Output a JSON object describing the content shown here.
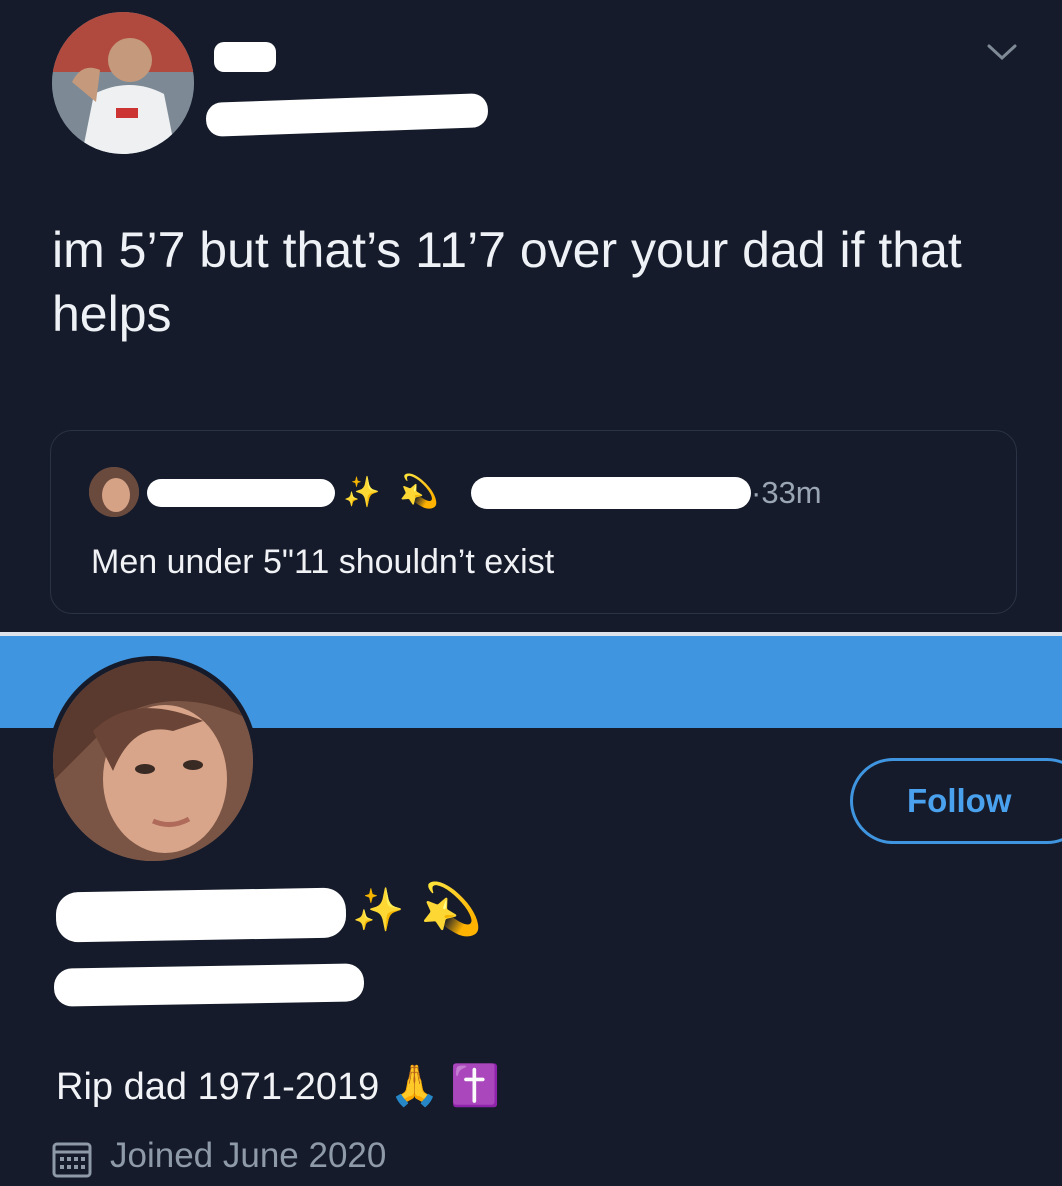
{
  "tweet": {
    "text": "im 5’7 but that’s 11’7 over your dad if that helps",
    "menu_icon": "chevron-down-icon",
    "quote": {
      "time": "·33m",
      "text": "Men under 5\"11 shouldn’t exist",
      "emojis": [
        "✨",
        "💫"
      ]
    }
  },
  "profile": {
    "banner_color": "#3f95df",
    "follow_label": "Follow",
    "name_emojis": [
      "✨",
      "💫"
    ],
    "bio": "Rip dad 1971-2019",
    "bio_emojis": [
      "🙏",
      "✝️"
    ],
    "joined": "Joined June 2020",
    "joined_icon": "calendar-icon"
  },
  "colors": {
    "background": "#151b2a",
    "accent": "#4aa1ee"
  }
}
